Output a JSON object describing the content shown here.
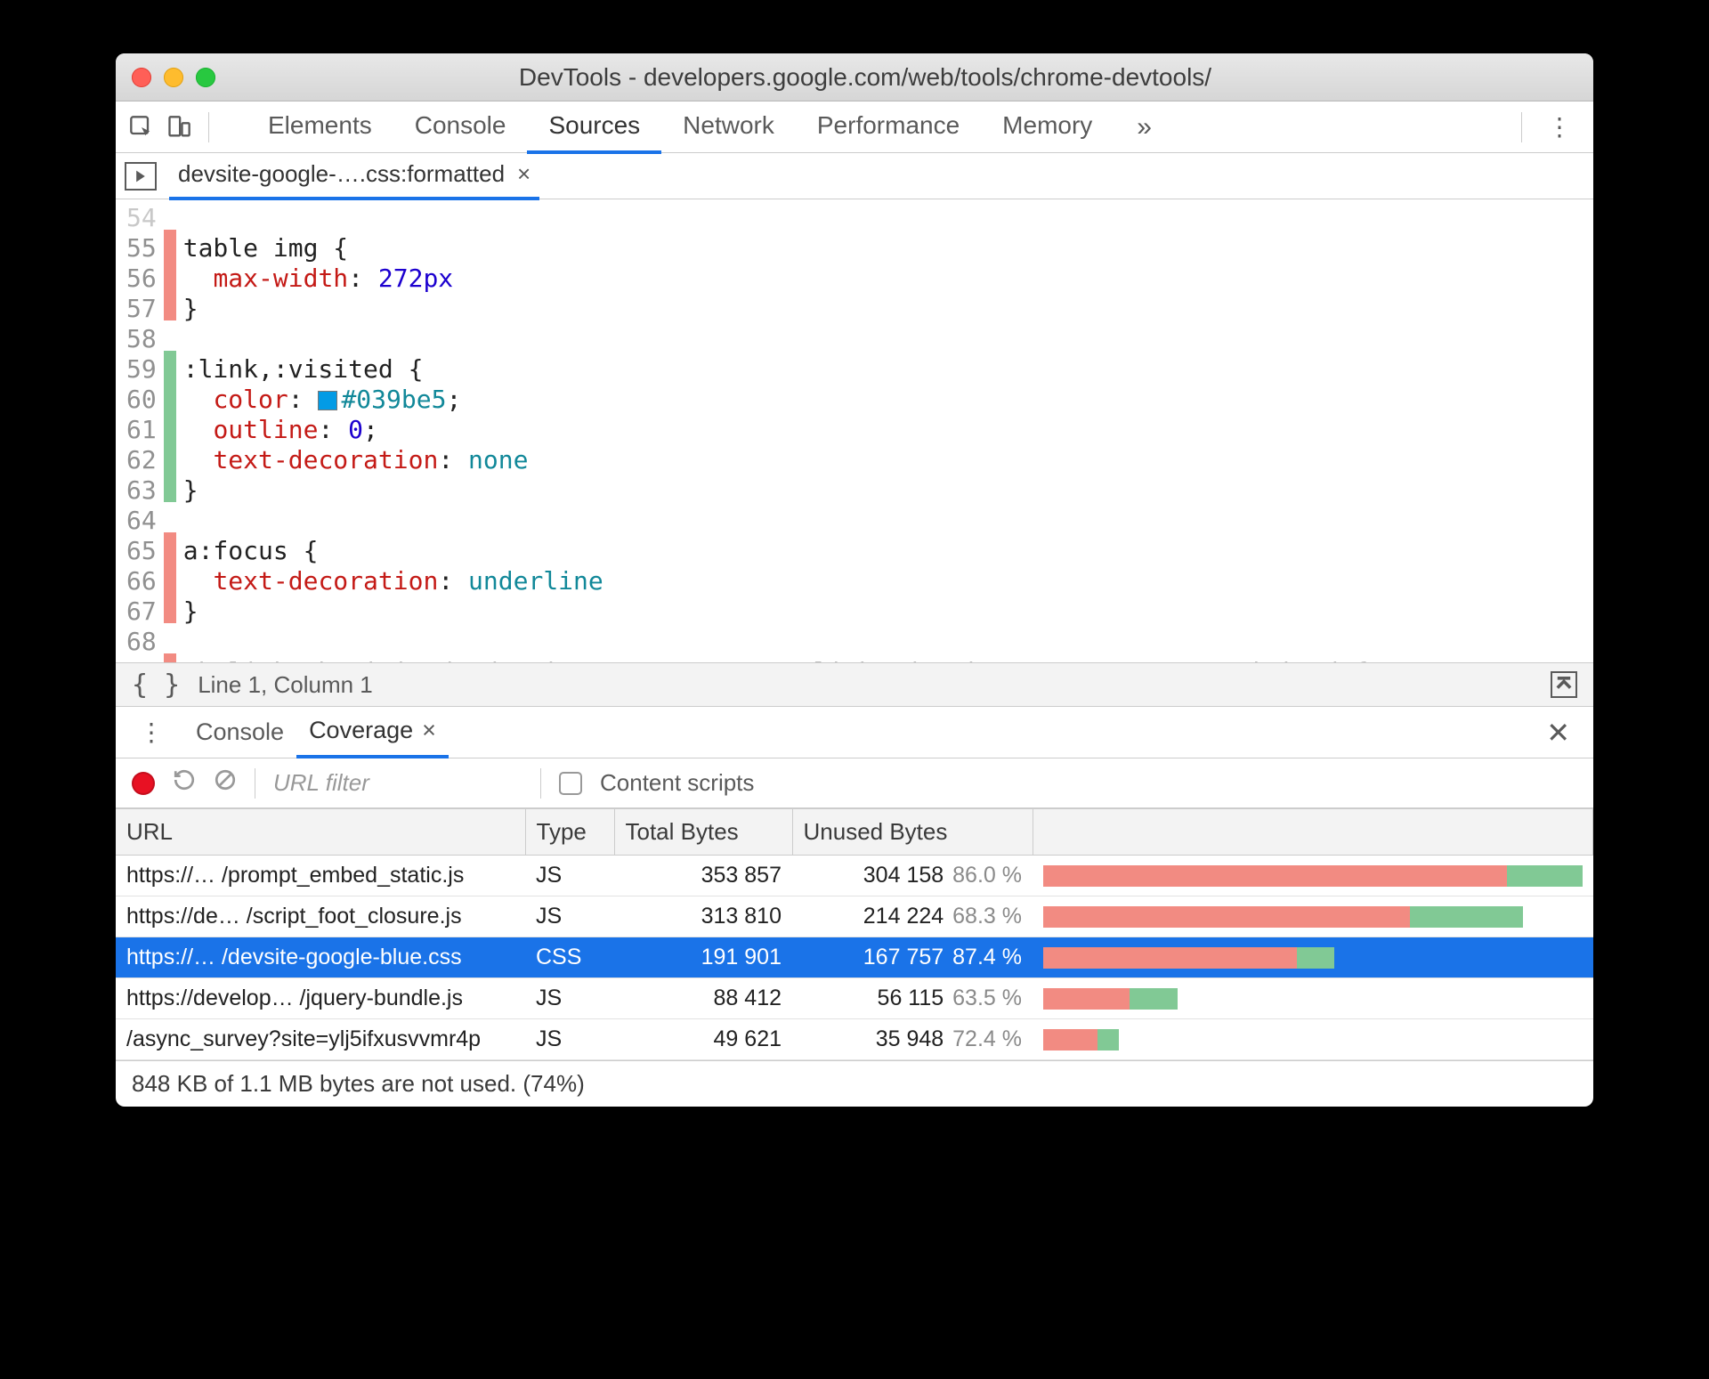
{
  "window": {
    "title": "DevTools - developers.google.com/web/tools/chrome-devtools/"
  },
  "tabs": {
    "items": [
      "Elements",
      "Console",
      "Sources",
      "Network",
      "Performance",
      "Memory"
    ],
    "active_index": 2,
    "more_glyph": "»"
  },
  "file_tab": {
    "label": "devsite-google-….css:formatted",
    "close": "×"
  },
  "code": {
    "first_faded_line_no": "54",
    "lines": [
      {
        "no": 55,
        "cov": "red",
        "html": "<span class='tok-sel'>table img {</span>"
      },
      {
        "no": 56,
        "cov": "red",
        "html": "  <span class='tok-prop'>max-width</span>: <span class='tok-val'>272px</span>"
      },
      {
        "no": 57,
        "cov": "red",
        "html": "<span class='tok-sel'>}</span>"
      },
      {
        "no": 58,
        "cov": "none",
        "html": ""
      },
      {
        "no": 59,
        "cov": "green",
        "html": "<span class='tok-sel'>:link,:visited {</span>"
      },
      {
        "no": 60,
        "cov": "green",
        "html": "  <span class='tok-prop'>color</span>: <span class='color-swatch'></span><span class='tok-keyword'>#039be5</span>;"
      },
      {
        "no": 61,
        "cov": "green",
        "html": "  <span class='tok-prop'>outline</span>: <span class='tok-val'>0</span>;"
      },
      {
        "no": 62,
        "cov": "green",
        "html": "  <span class='tok-prop'>text-decoration</span>: <span class='tok-keyword'>none</span>"
      },
      {
        "no": 63,
        "cov": "green",
        "html": "<span class='tok-sel'>}</span>"
      },
      {
        "no": 64,
        "cov": "none",
        "html": ""
      },
      {
        "no": 65,
        "cov": "red",
        "html": "<span class='tok-sel'>a:focus {</span>"
      },
      {
        "no": 66,
        "cov": "red",
        "html": "  <span class='tok-prop'>text-decoration</span>: <span class='tok-keyword'>underline</span>"
      },
      {
        "no": 67,
        "cov": "red",
        "html": "<span class='tok-sel'>}</span>"
      },
      {
        "no": 68,
        "cov": "none",
        "html": ""
      }
    ],
    "trailing_faded": "th link th visited  devsite toast content link  devsite toast content visited {"
  },
  "code_status": {
    "braces": "{ }",
    "position": "Line 1, Column 1"
  },
  "drawer": {
    "kebab": "⋮",
    "tabs": [
      "Console",
      "Coverage"
    ],
    "active_index": 1,
    "close_x": "×"
  },
  "cov_toolbar": {
    "url_filter_placeholder": "URL filter",
    "content_scripts_label": "Content scripts"
  },
  "cov_table": {
    "headers": [
      "URL",
      "Type",
      "Total Bytes",
      "Unused Bytes",
      ""
    ],
    "rows": [
      {
        "url": "https://… /prompt_embed_static.js",
        "type": "JS",
        "total": "353 857",
        "unused": "304 158",
        "pct": "86.0 %",
        "bar_unused": 86,
        "bar_total": 100,
        "selected": false
      },
      {
        "url": "https://de… /script_foot_closure.js",
        "type": "JS",
        "total": "313 810",
        "unused": "214 224",
        "pct": "68.3 %",
        "bar_unused": 68,
        "bar_total": 89,
        "selected": false
      },
      {
        "url": "https://… /devsite-google-blue.css",
        "type": "CSS",
        "total": "191 901",
        "unused": "167 757",
        "pct": "87.4 %",
        "bar_unused": 47,
        "bar_total": 54,
        "selected": true
      },
      {
        "url": "https://develop… /jquery-bundle.js",
        "type": "JS",
        "total": "88 412",
        "unused": "56 115",
        "pct": "63.5 %",
        "bar_unused": 16,
        "bar_total": 25,
        "selected": false
      },
      {
        "url": "/async_survey?site=ylj5ifxusvvmr4p",
        "type": "JS",
        "total": "49 621",
        "unused": "35 948",
        "pct": "72.4 %",
        "bar_unused": 10,
        "bar_total": 14,
        "selected": false
      }
    ],
    "footer": "848 KB of 1.1 MB bytes are not used. (74%)"
  }
}
